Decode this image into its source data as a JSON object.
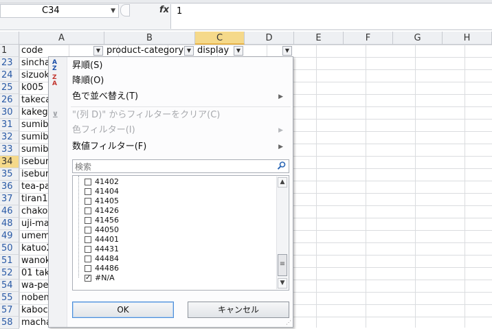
{
  "formula_bar": {
    "name_box": "C34",
    "fx": "fx",
    "value": "1"
  },
  "columns": [
    "A",
    "B",
    "C",
    "D",
    "E",
    "F",
    "G",
    "H"
  ],
  "header_row": {
    "num": "1",
    "A": "code",
    "B": "product-category",
    "C": "display"
  },
  "rows": [
    {
      "num": "23",
      "a": "sincha"
    },
    {
      "num": "24",
      "a": "sizuok"
    },
    {
      "num": "25",
      "a": "k005"
    },
    {
      "num": "26",
      "a": "takeca"
    },
    {
      "num": "30",
      "a": "kakega"
    },
    {
      "num": "31",
      "a": "sumibi"
    },
    {
      "num": "32",
      "a": "sumibi"
    },
    {
      "num": "33",
      "a": "sumibi"
    },
    {
      "num": "34",
      "a": "isebur"
    },
    {
      "num": "35",
      "a": "isebur"
    },
    {
      "num": "36",
      "a": "tea-pa"
    },
    {
      "num": "37",
      "a": "tiran1("
    },
    {
      "num": "46",
      "a": "chako"
    },
    {
      "num": "48",
      "a": "uji-ma"
    },
    {
      "num": "49",
      "a": "umema"
    },
    {
      "num": "50",
      "a": "katuo2"
    },
    {
      "num": "51",
      "a": "wanok"
    },
    {
      "num": "52",
      "a": "01 take"
    },
    {
      "num": "54",
      "a": "wa-pe"
    },
    {
      "num": "55",
      "a": "noben"
    },
    {
      "num": "57",
      "a": "kaboc"
    },
    {
      "num": "58",
      "a": "macha"
    }
  ],
  "menu": {
    "sort_asc": "昇順(S)",
    "sort_desc": "降順(O)",
    "sort_by_color": "色で並べ替え(T)",
    "clear_filter": "\"(列 D)\" からフィルターをクリア(C)",
    "color_filter": "色フィルター(I)",
    "number_filter": "数値フィルター(F)",
    "search_placeholder": "検索",
    "items": [
      {
        "label": "41402",
        "checked": false
      },
      {
        "label": "41404",
        "checked": false
      },
      {
        "label": "41405",
        "checked": false
      },
      {
        "label": "41426",
        "checked": false
      },
      {
        "label": "41456",
        "checked": false
      },
      {
        "label": "44050",
        "checked": false
      },
      {
        "label": "44401",
        "checked": false
      },
      {
        "label": "44431",
        "checked": false
      },
      {
        "label": "44484",
        "checked": false
      },
      {
        "label": "44486",
        "checked": false
      },
      {
        "label": "#N/A",
        "checked": true
      }
    ],
    "ok": "OK",
    "cancel": "キャンセル"
  }
}
